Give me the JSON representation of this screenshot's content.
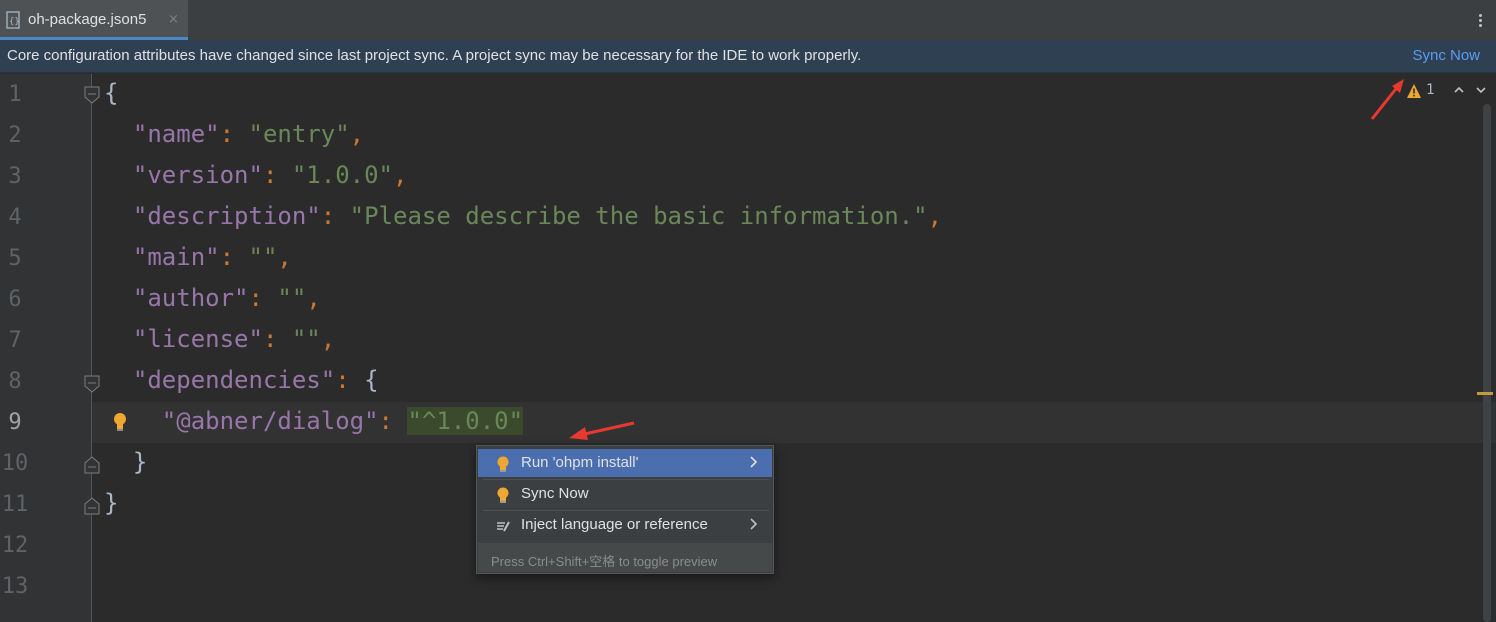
{
  "tab": {
    "title": "oh-package.json5",
    "close": "×"
  },
  "banner": {
    "message": "Core configuration attributes have changed since last project sync. A project sync may be necessary for the IDE to work properly.",
    "action": "Sync Now"
  },
  "inspections": {
    "warning_count": "1"
  },
  "editor": {
    "current_line": 9,
    "line_numbers": [
      "1",
      "2",
      "3",
      "4",
      "5",
      "6",
      "7",
      "8",
      "9",
      "10",
      "11",
      "12",
      "13"
    ],
    "lines": [
      [
        {
          "t": "{",
          "c": "b"
        }
      ],
      [
        {
          "t": "  ",
          "c": "b"
        },
        {
          "t": "\"name\"",
          "c": "k"
        },
        {
          "t": ": ",
          "c": "p"
        },
        {
          "t": "\"entry\"",
          "c": "s"
        },
        {
          "t": ",",
          "c": "p"
        }
      ],
      [
        {
          "t": "  ",
          "c": "b"
        },
        {
          "t": "\"version\"",
          "c": "k"
        },
        {
          "t": ": ",
          "c": "p"
        },
        {
          "t": "\"1.0.0\"",
          "c": "s"
        },
        {
          "t": ",",
          "c": "p"
        }
      ],
      [
        {
          "t": "  ",
          "c": "b"
        },
        {
          "t": "\"description\"",
          "c": "k"
        },
        {
          "t": ": ",
          "c": "p"
        },
        {
          "t": "\"Please describe the basic information.\"",
          "c": "s"
        },
        {
          "t": ",",
          "c": "p"
        }
      ],
      [
        {
          "t": "  ",
          "c": "b"
        },
        {
          "t": "\"main\"",
          "c": "k"
        },
        {
          "t": ": ",
          "c": "p"
        },
        {
          "t": "\"\"",
          "c": "s"
        },
        {
          "t": ",",
          "c": "p"
        }
      ],
      [
        {
          "t": "  ",
          "c": "b"
        },
        {
          "t": "\"author\"",
          "c": "k"
        },
        {
          "t": ": ",
          "c": "p"
        },
        {
          "t": "\"\"",
          "c": "s"
        },
        {
          "t": ",",
          "c": "p"
        }
      ],
      [
        {
          "t": "  ",
          "c": "b"
        },
        {
          "t": "\"license\"",
          "c": "k"
        },
        {
          "t": ": ",
          "c": "p"
        },
        {
          "t": "\"\"",
          "c": "s"
        },
        {
          "t": ",",
          "c": "p"
        }
      ],
      [
        {
          "t": "  ",
          "c": "b"
        },
        {
          "t": "\"dependencies\"",
          "c": "k"
        },
        {
          "t": ": ",
          "c": "p"
        },
        {
          "t": "{",
          "c": "b"
        }
      ],
      [
        {
          "t": "    ",
          "c": "b"
        },
        {
          "t": "\"@abner/dialog\"",
          "c": "k"
        },
        {
          "t": ": ",
          "c": "p"
        },
        {
          "t": "\"^1.0.0\"",
          "c": "s hl"
        }
      ],
      [
        {
          "t": "  ",
          "c": "b"
        },
        {
          "t": "}",
          "c": "b"
        }
      ],
      [
        {
          "t": "}",
          "c": "b"
        }
      ],
      [],
      []
    ]
  },
  "popup": {
    "items": [
      {
        "label": "Run 'ohpm install'",
        "icon": "bulb-icon",
        "submenu": true
      },
      {
        "label": "Sync Now",
        "icon": "bulb-icon",
        "submenu": false
      },
      {
        "label": "Inject language or reference",
        "icon": "inject-icon",
        "submenu": true
      }
    ],
    "footer": "Press Ctrl+Shift+空格 to toggle preview"
  },
  "colors": {
    "background": "#2b2b2b",
    "gutter": "#313335",
    "key": "#9876aa",
    "string": "#6a8759",
    "punct": "#cc7832",
    "selection": "#4b6eaf",
    "link": "#589df6",
    "annotation_arrow": "#e8392f"
  }
}
